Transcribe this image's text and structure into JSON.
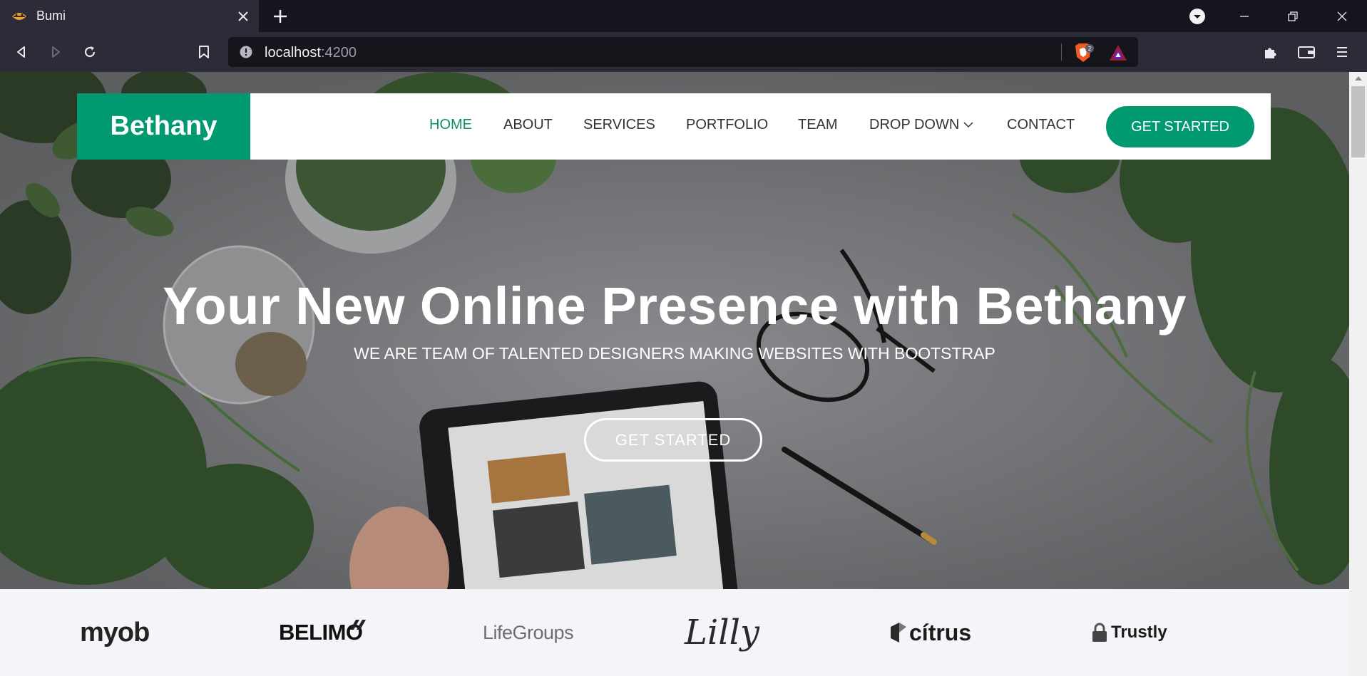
{
  "browser": {
    "tab": {
      "title": "Bumi",
      "favicon": "bumi-favicon-icon"
    },
    "url": {
      "host": "localhost",
      "port": ":4200"
    },
    "shield_count": "2"
  },
  "nav": {
    "brand": "Bethany",
    "items": [
      {
        "label": "HOME",
        "active": true
      },
      {
        "label": "ABOUT"
      },
      {
        "label": "SERVICES"
      },
      {
        "label": "PORTFOLIO"
      },
      {
        "label": "TEAM"
      },
      {
        "label": "DROP DOWN"
      },
      {
        "label": "CONTACT"
      }
    ],
    "cta": "GET STARTED"
  },
  "hero": {
    "title": "Your New Online Presence with Bethany",
    "subtitle": "WE ARE TEAM OF TALENTED DESIGNERS MAKING WEBSITES WITH BOOTSTRAP",
    "button": "GET STARTED"
  },
  "clients": [
    "myob",
    "BELIMO",
    "LifeGroups",
    "Lilly",
    "cítrus",
    "Trustly"
  ],
  "colors": {
    "accent": "#009970",
    "active_link": "#0e8d6a",
    "chrome_dark": "#15151f",
    "chrome_mid": "#2b2c37"
  }
}
